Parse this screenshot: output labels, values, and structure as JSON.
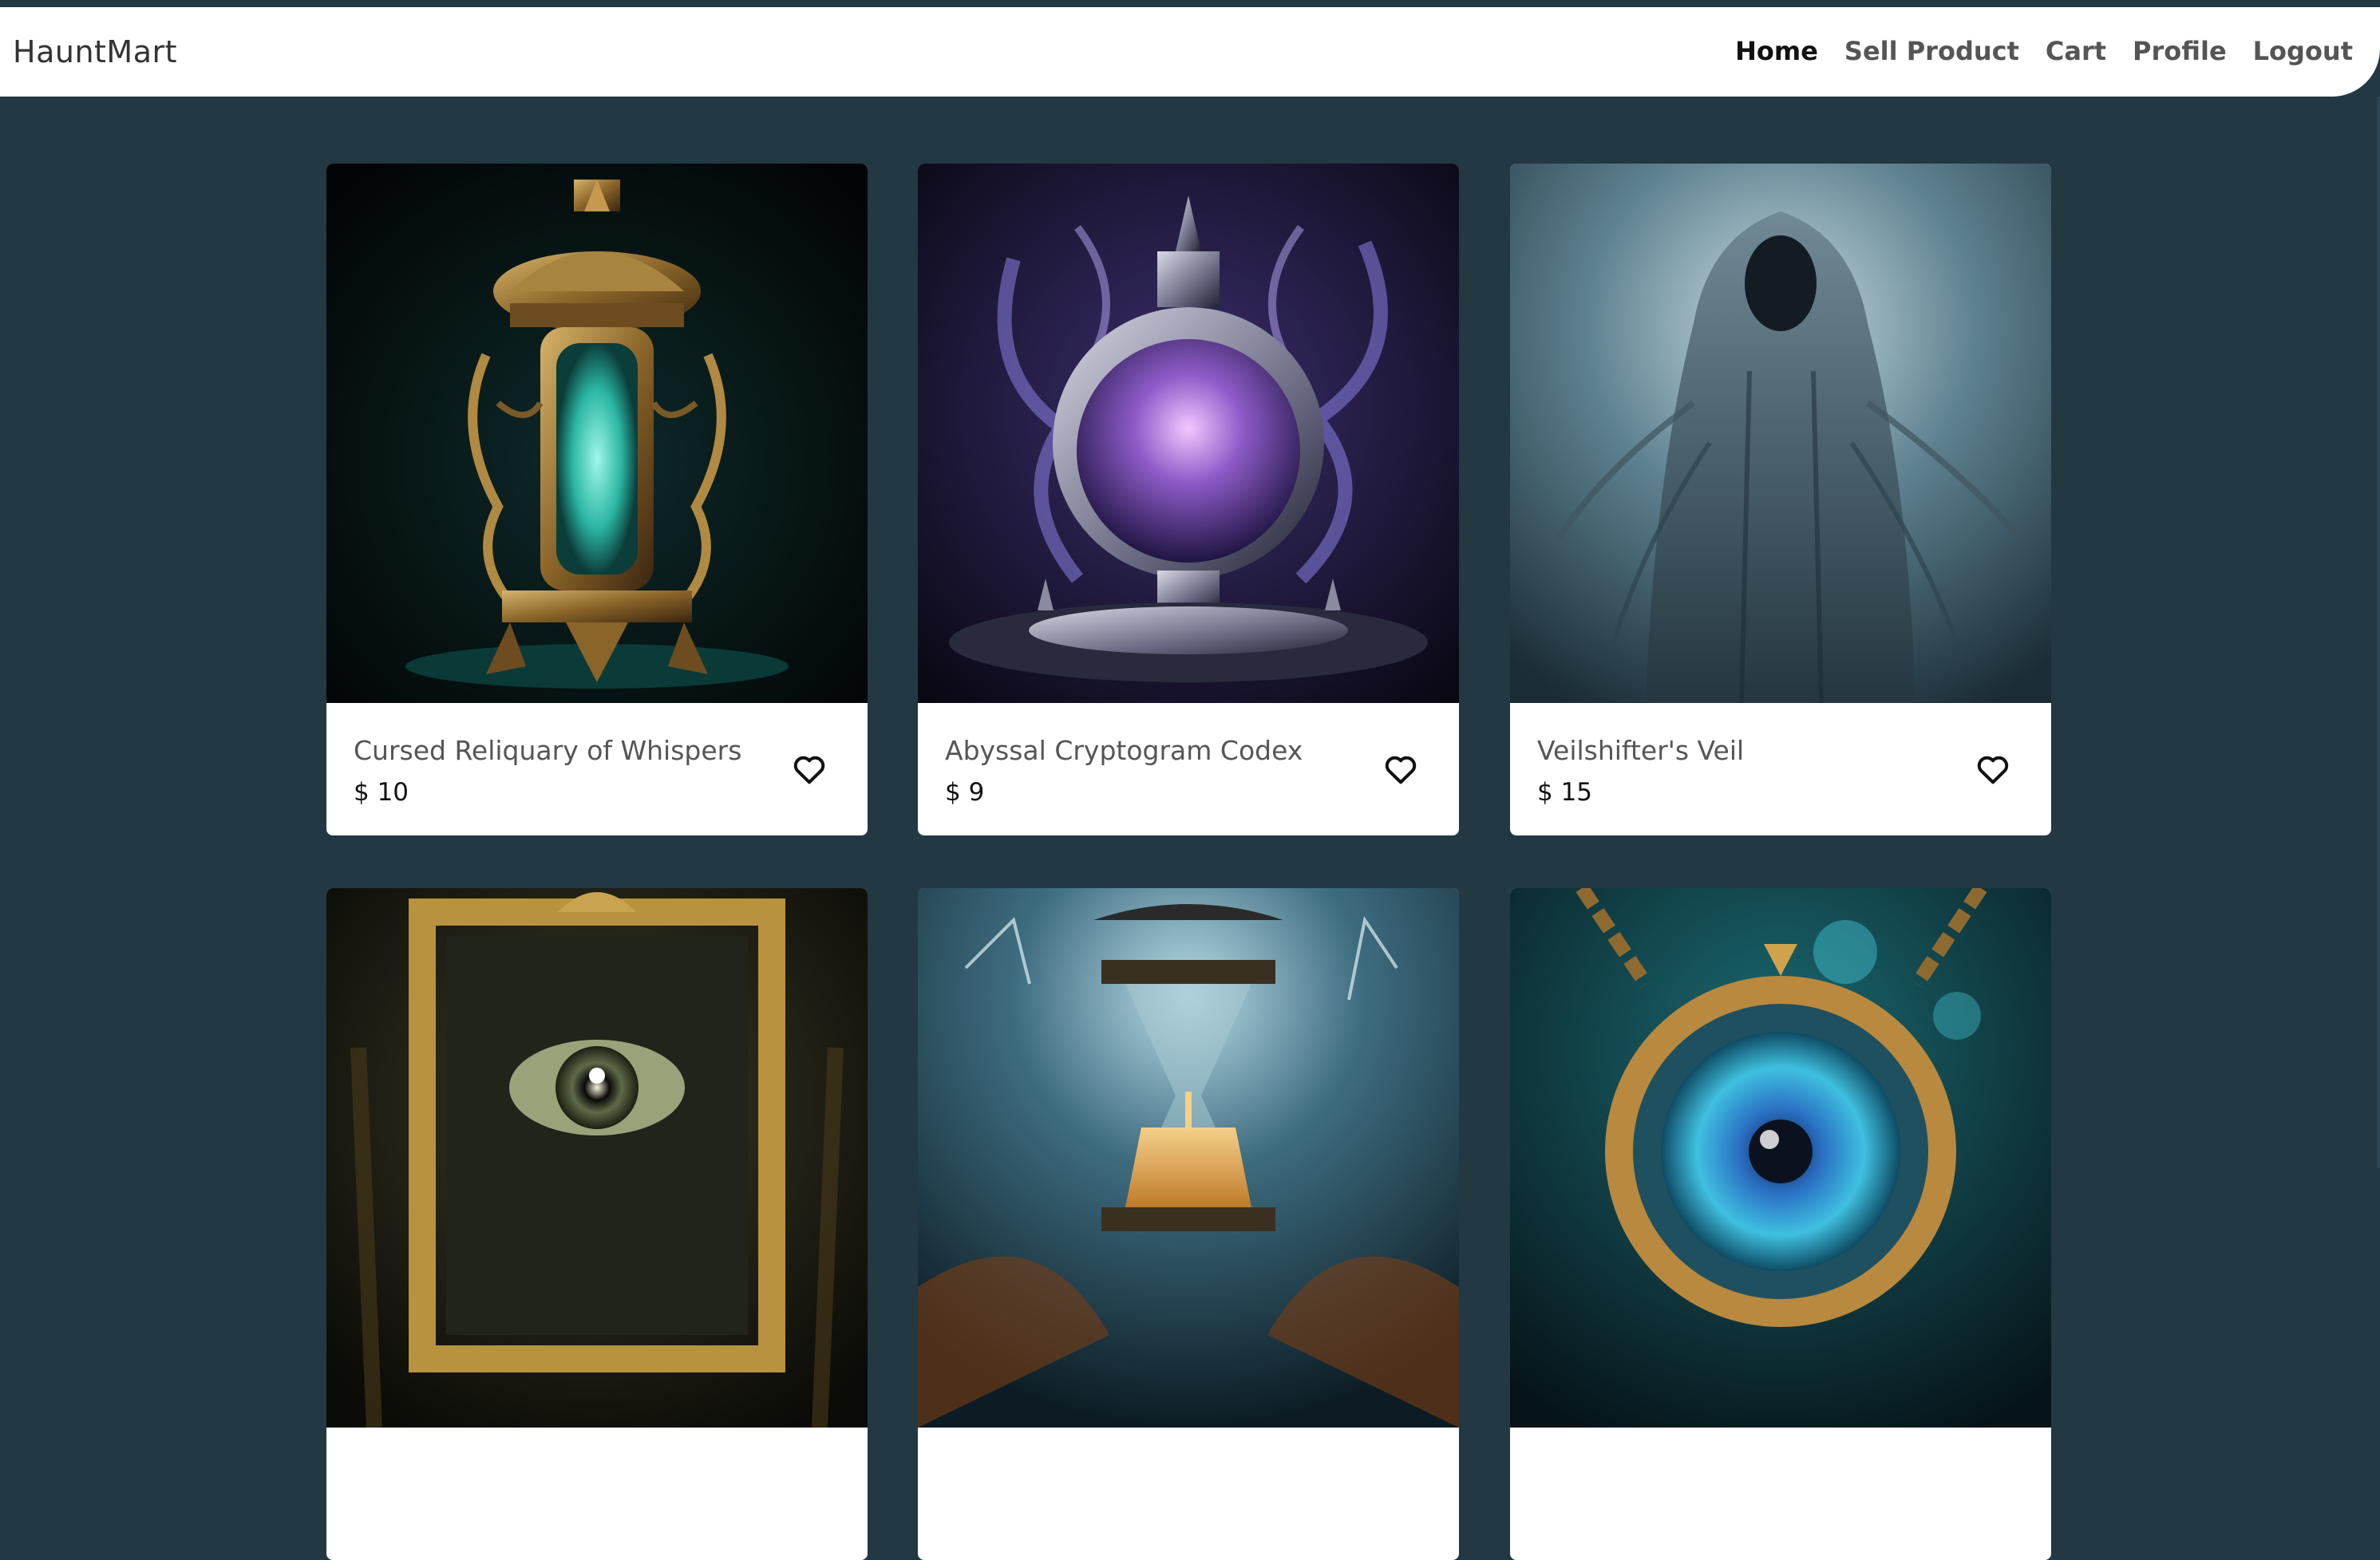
{
  "brand": "HauntMart",
  "nav": {
    "home": "Home",
    "sell": "Sell Product",
    "cart": "Cart",
    "profile": "Profile",
    "logout": "Logout"
  },
  "products": [
    {
      "title": "Cursed Reliquary of Whispers",
      "price": "$ 10",
      "image": "ornate-lantern-image"
    },
    {
      "title": "Abyssal Cryptogram Codex",
      "price": "$ 9",
      "image": "purple-smoke-urn-image"
    },
    {
      "title": "Veilshifter's Veil",
      "price": "$ 15",
      "image": "hooded-wraith-image"
    },
    {
      "title": "",
      "price": "",
      "image": "framed-eye-mirror-image"
    },
    {
      "title": "",
      "price": "",
      "image": "storm-hourglass-image"
    },
    {
      "title": "",
      "price": "",
      "image": "eye-amulet-image"
    }
  ],
  "colors": {
    "page_background": "#223843",
    "navbar": "#ffffff",
    "card": "#ffffff",
    "title_text": "#555555",
    "active_nav": "#111111"
  },
  "icons": {
    "favorite": "heart-outline-icon"
  }
}
